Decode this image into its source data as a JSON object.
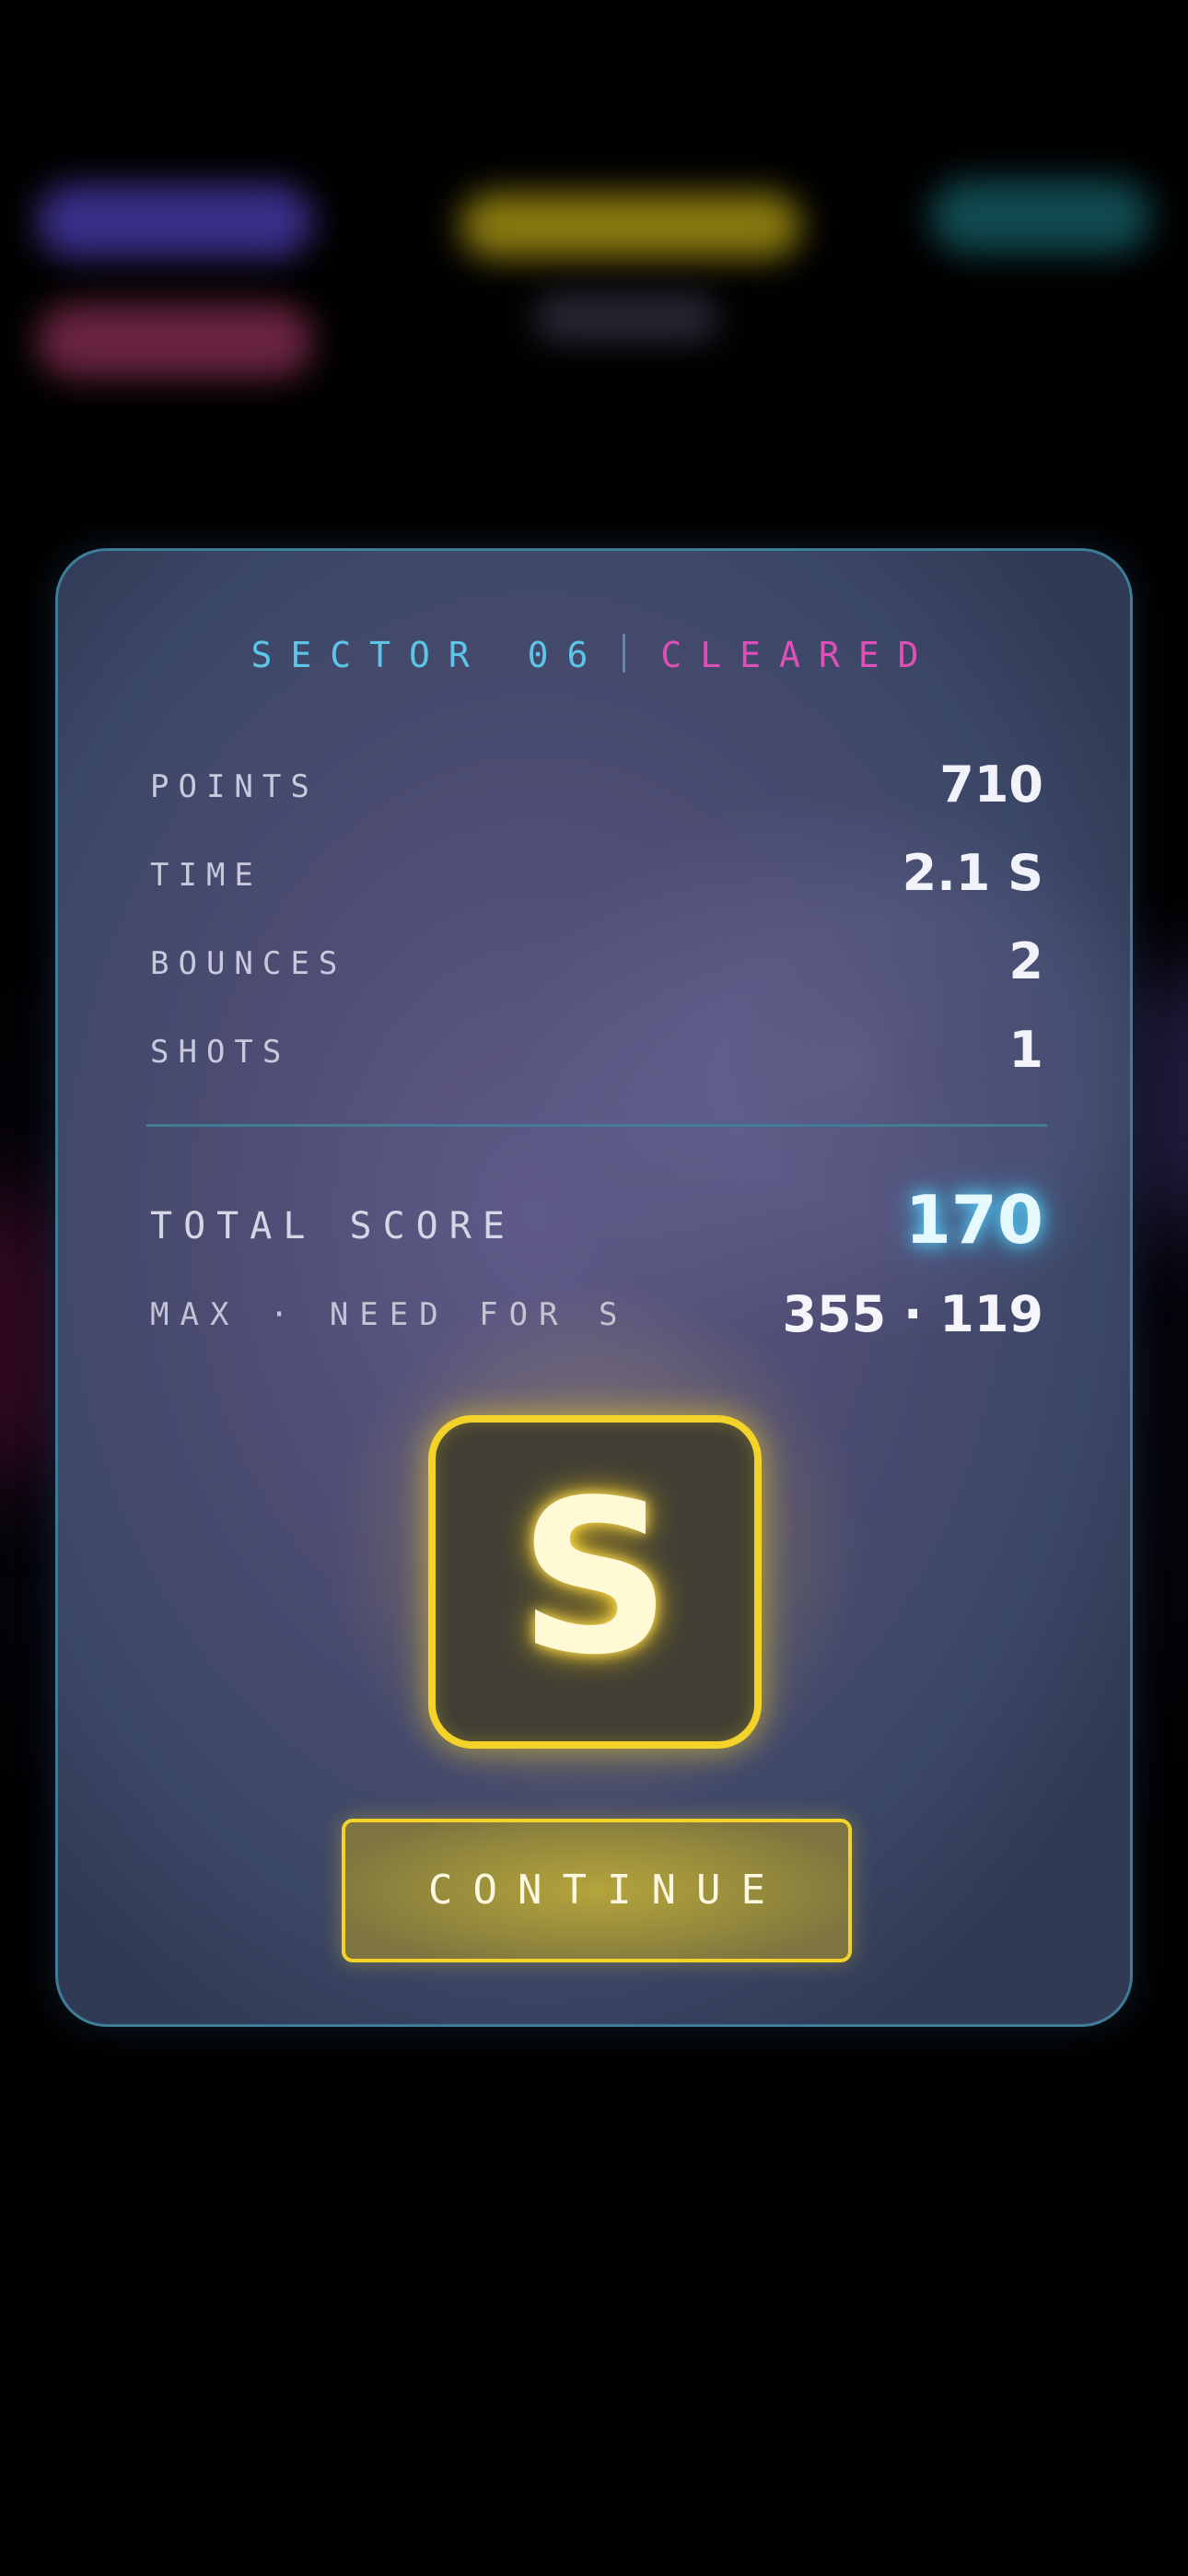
{
  "header": {
    "sector": "SECTOR 06",
    "status": "CLEARED"
  },
  "stats": [
    {
      "label": "POINTS",
      "value": "710"
    },
    {
      "label": "TIME",
      "value": "2.1 S"
    },
    {
      "label": "BOUNCES",
      "value": "2"
    },
    {
      "label": "SHOTS",
      "value": "1"
    }
  ],
  "total": {
    "label": "TOTAL SCORE",
    "value": "170"
  },
  "max": {
    "label": "MAX · NEED FOR S",
    "value": "355 · 119"
  },
  "grade": {
    "letter": "S"
  },
  "actions": {
    "continue_label": "CONTINUE"
  },
  "colors": {
    "accent_cyan": "#5cc6e8",
    "accent_magenta": "#e04fb8",
    "accent_yellow": "#f3d22a",
    "card_border": "#3e7d98"
  }
}
